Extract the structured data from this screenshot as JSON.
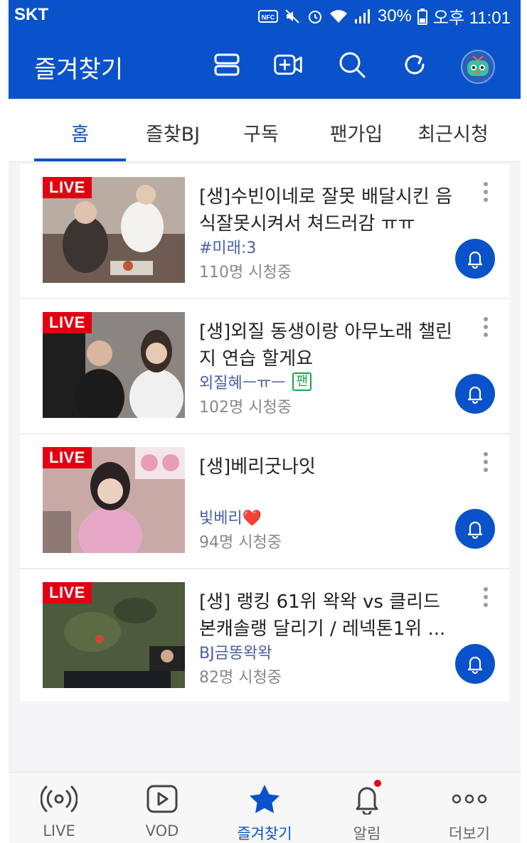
{
  "status_bar": {
    "carrier": "SKT",
    "battery": "30%",
    "time": "오후 11:01"
  },
  "header": {
    "title": "즐겨찾기"
  },
  "tabs": [
    {
      "label": "홈",
      "active": true
    },
    {
      "label": "즐찾BJ",
      "active": false
    },
    {
      "label": "구독",
      "active": false
    },
    {
      "label": "팬가입",
      "active": false
    },
    {
      "label": "최근시청",
      "active": false
    }
  ],
  "streams": [
    {
      "badge": "LIVE",
      "title": "[생]수빈이네로 잘못 배달시킨 음식잘못시켜서 쳐드러감 ㅠㅠ",
      "bj": "#미래:3",
      "viewers": "110명 시청중"
    },
    {
      "badge": "LIVE",
      "title": "[생]외질 동생이랑 아무노래 챌린지 연습 할게요",
      "bj": "외질혜ㅡㅠㅡ",
      "fan_badge": "팬",
      "viewers": "102명 시청중"
    },
    {
      "badge": "LIVE",
      "title": "[생]베리굿나잇",
      "bj": "빛베리❤️",
      "viewers": "94명 시청중"
    },
    {
      "badge": "LIVE",
      "title": "[생] 랭킹 61위 왁왁 vs 클리드 본캐솔랭 달리기 / 레넥톤1위 ...",
      "bj": "BJ금똥왁왁",
      "viewers": "82명 시청중"
    }
  ],
  "bottom_nav": [
    {
      "label": "LIVE",
      "icon": "broadcast-icon"
    },
    {
      "label": "VOD",
      "icon": "play-icon"
    },
    {
      "label": "즐겨찾기",
      "icon": "star-icon",
      "active": true
    },
    {
      "label": "알림",
      "icon": "bell-icon",
      "has_badge": true
    },
    {
      "label": "더보기",
      "icon": "more-icon"
    }
  ],
  "colors": {
    "brand": "#0a52c9",
    "live": "#e00012",
    "bj": "#4a5ea8",
    "fan": "#1ea34b"
  }
}
